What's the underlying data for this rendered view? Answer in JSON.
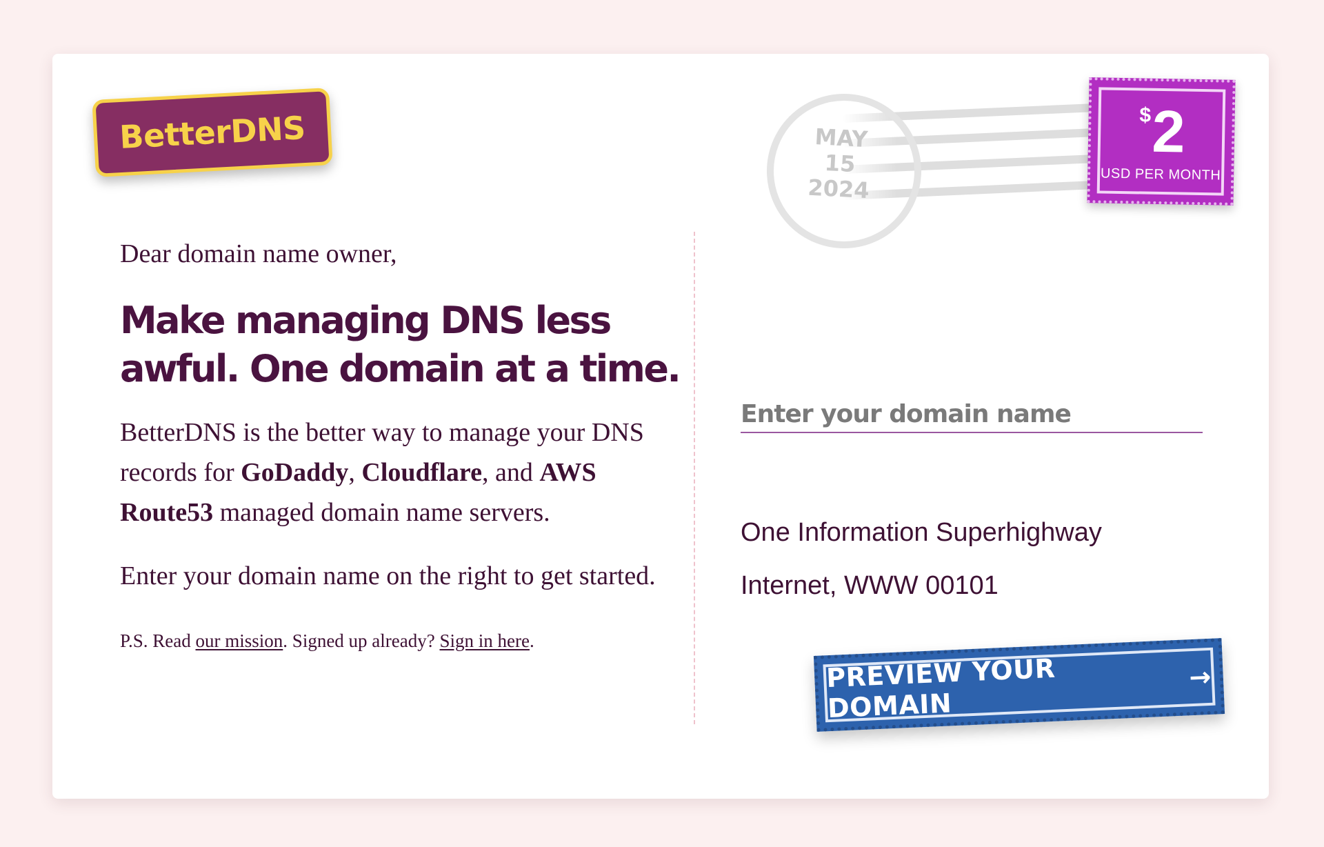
{
  "logo": {
    "text": "BetterDNS"
  },
  "left": {
    "greeting": "Dear domain name owner,",
    "headline_line1": "Make managing DNS less",
    "headline_line2": "awful. One domain at a time.",
    "intro_pre": "BetterDNS is the better way to manage your DNS records for ",
    "provider1": "GoDaddy",
    "sep1": ", ",
    "provider2": "Cloudflare",
    "sep2": ", and ",
    "provider3": "AWS Route53",
    "intro_post": " managed domain name servers.",
    "instruction": "Enter your domain name on the right to get started.",
    "ps_pre": "P.S. Read ",
    "mission_link": "our mission",
    "ps_mid": ". Signed up already? ",
    "signin_link": "Sign in here",
    "ps_end": "."
  },
  "postmark": {
    "month": "MAY",
    "day": "15",
    "year": "2024"
  },
  "stamp": {
    "currency": "$",
    "amount": "2",
    "unit": "USD PER MONTH"
  },
  "form": {
    "domain_placeholder": "Enter your domain name",
    "domain_value": ""
  },
  "address": {
    "line1": "One Information Superhighway",
    "line2": "Internet, WWW 00101"
  },
  "cta": {
    "label": "PREVIEW YOUR DOMAIN",
    "arrow_icon": "arrow-right-icon"
  },
  "colors": {
    "page_background": "#fcf0f0",
    "brand_plum": "#862e62",
    "brand_yellow": "#f7d24a",
    "stamp_magenta": "#b22ec2",
    "cta_blue": "#2d62ad",
    "text": "#3e1134"
  }
}
